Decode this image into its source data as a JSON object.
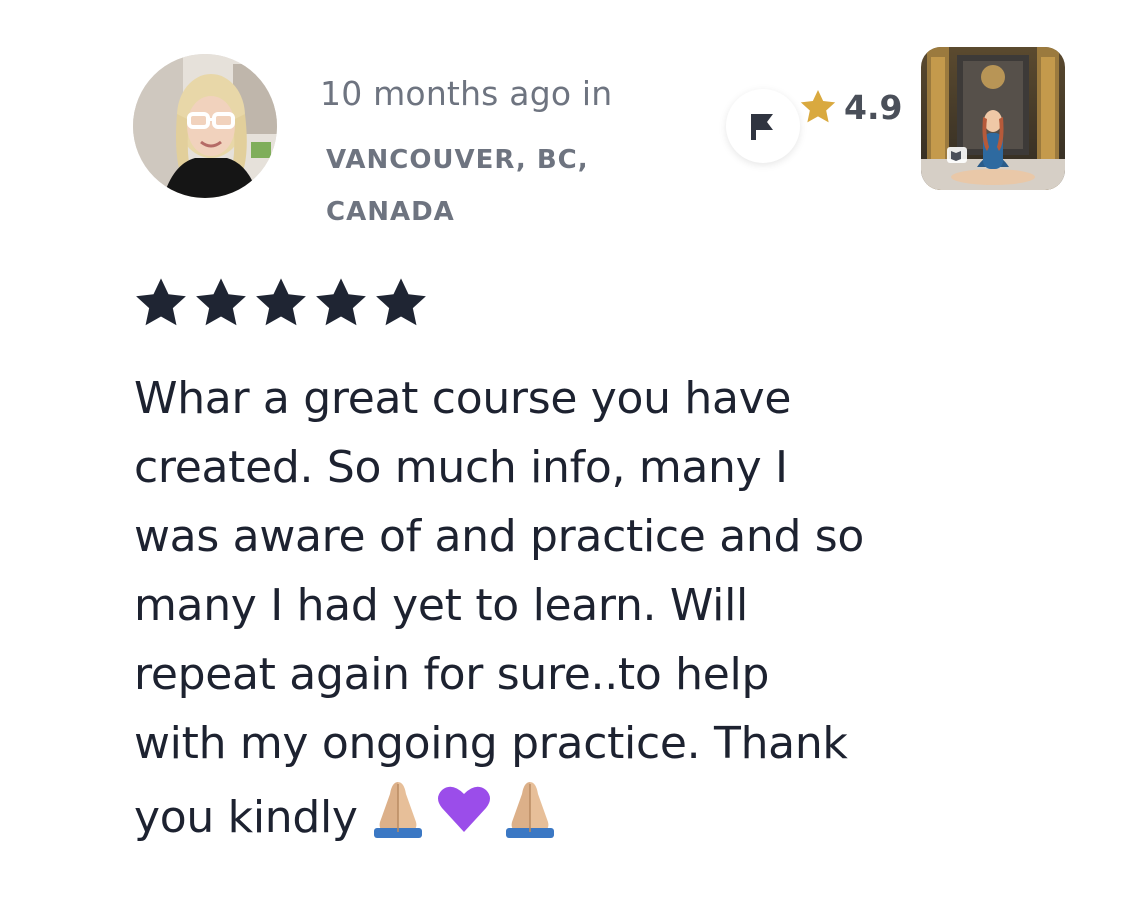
{
  "review": {
    "time_ago": "10 months ago in",
    "location": "VANCOUVER, BC, CANADA",
    "stars": 5,
    "text": "Whar a great course you have created. So much info, many I was aware of and practice and so many I had yet to learn. Will repeat again for sure..to help with my ongoing practice. Thank you kindly",
    "trailing_emojis": [
      "folded-hands",
      "purple-heart",
      "folded-hands"
    ]
  },
  "course": {
    "rating": "4.9"
  },
  "icons": {
    "flag": "flag-icon",
    "rating_star": "star-icon",
    "review_star": "star-icon"
  },
  "colors": {
    "rating_star": "#d9a93f",
    "review_star": "#1f2533",
    "meta_text": "#6e7480",
    "body_text": "#1d2230",
    "purple_heart": "#9b4dea"
  }
}
